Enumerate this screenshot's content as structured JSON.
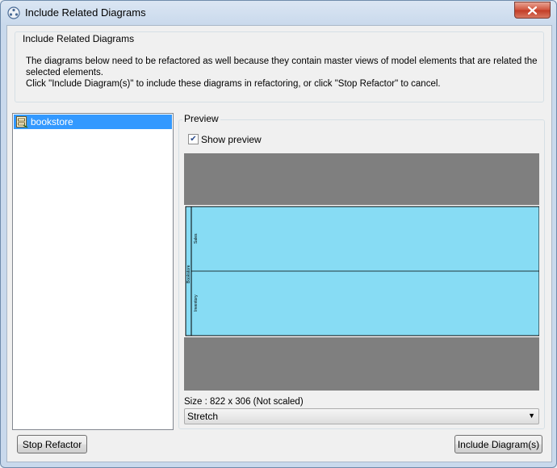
{
  "window": {
    "title": "Include Related Diagrams",
    "close_icon": "close-icon",
    "app_icon": "app-icon"
  },
  "info": {
    "group_title": "Include Related Diagrams",
    "line1": "The diagrams below need to be refactored as well because they contain master views of model elements that are related the",
    "line2": "selected elements.",
    "line3": "Click \"Include Diagram(s)\" to include these diagrams in refactoring, or click \"Stop Refactor\" to cancel."
  },
  "tree": {
    "items": [
      {
        "label": "bookstore",
        "icon": "diagram-icon",
        "selected": true
      }
    ]
  },
  "preview": {
    "group_title": "Preview",
    "show_preview_label": "Show preview",
    "show_preview_checked": true,
    "diagram": {
      "pool_label": "Bookstore",
      "lanes": [
        "Sales",
        "Inventory"
      ],
      "fill_color": "#87dcf4"
    },
    "size_text": "Size : 822 x 306 (Not scaled)",
    "scale_mode": {
      "selected": "Stretch"
    }
  },
  "buttons": {
    "stop_refactor": "Stop Refactor",
    "include_diagrams": "Include Diagram(s)"
  }
}
